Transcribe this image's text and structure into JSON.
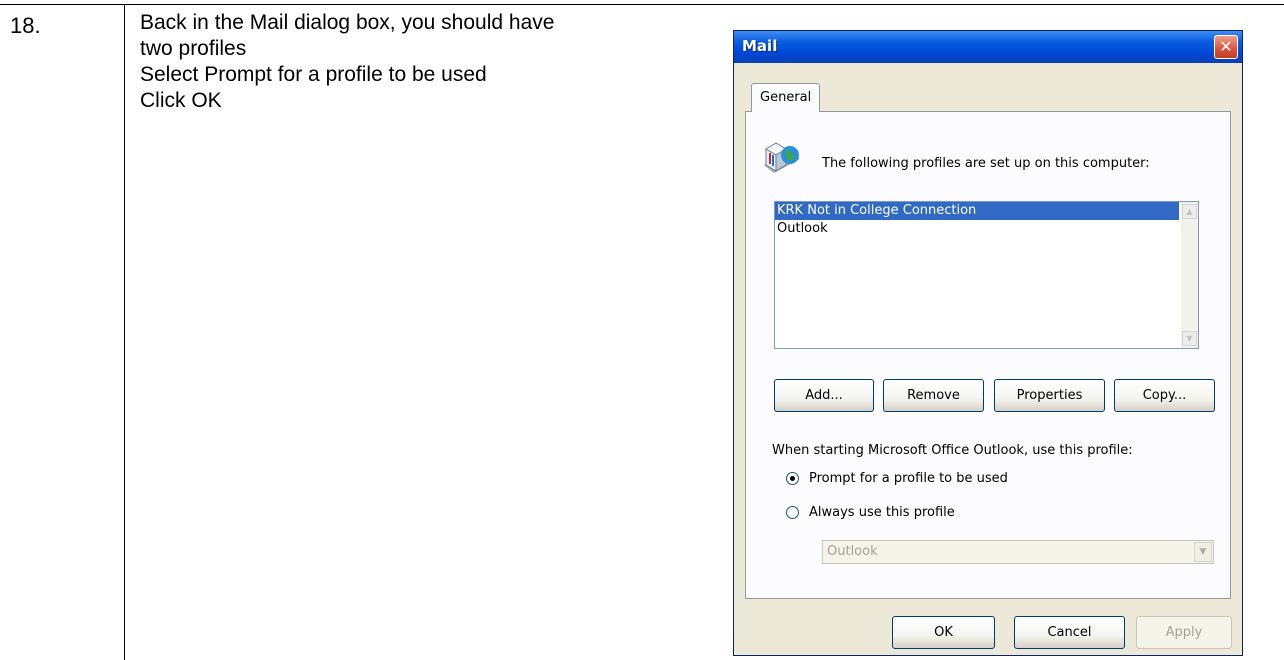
{
  "document": {
    "step_number": "18.",
    "instructions": [
      "Back in the Mail dialog box, you should have",
      "two profiles",
      "Select Prompt for a profile to be used",
      "Click OK"
    ]
  },
  "dialog": {
    "title": "Mail",
    "close_icon": "close-icon",
    "tab_label": "General",
    "intro_text": "The following profiles are set up on this computer:",
    "profiles": [
      "KRK Not in College Connection",
      "Outlook"
    ],
    "selected_profile": "KRK Not in College Connection",
    "buttons": {
      "add": "Add...",
      "remove": "Remove",
      "properties": "Properties",
      "copy": "Copy..."
    },
    "startup_label": "When starting Microsoft Office Outlook, use this profile:",
    "radio_prompt": "Prompt for a profile to be used",
    "radio_always": "Always use this profile",
    "selected_radio": "Prompt for a profile to be used",
    "profile_dropdown_value": "Outlook",
    "footer": {
      "ok": "OK",
      "cancel": "Cancel",
      "apply": "Apply"
    }
  },
  "colors": {
    "titlebar": "#0a5ce0",
    "selection": "#316ac5",
    "dialog_bg": "#ece9d8"
  }
}
